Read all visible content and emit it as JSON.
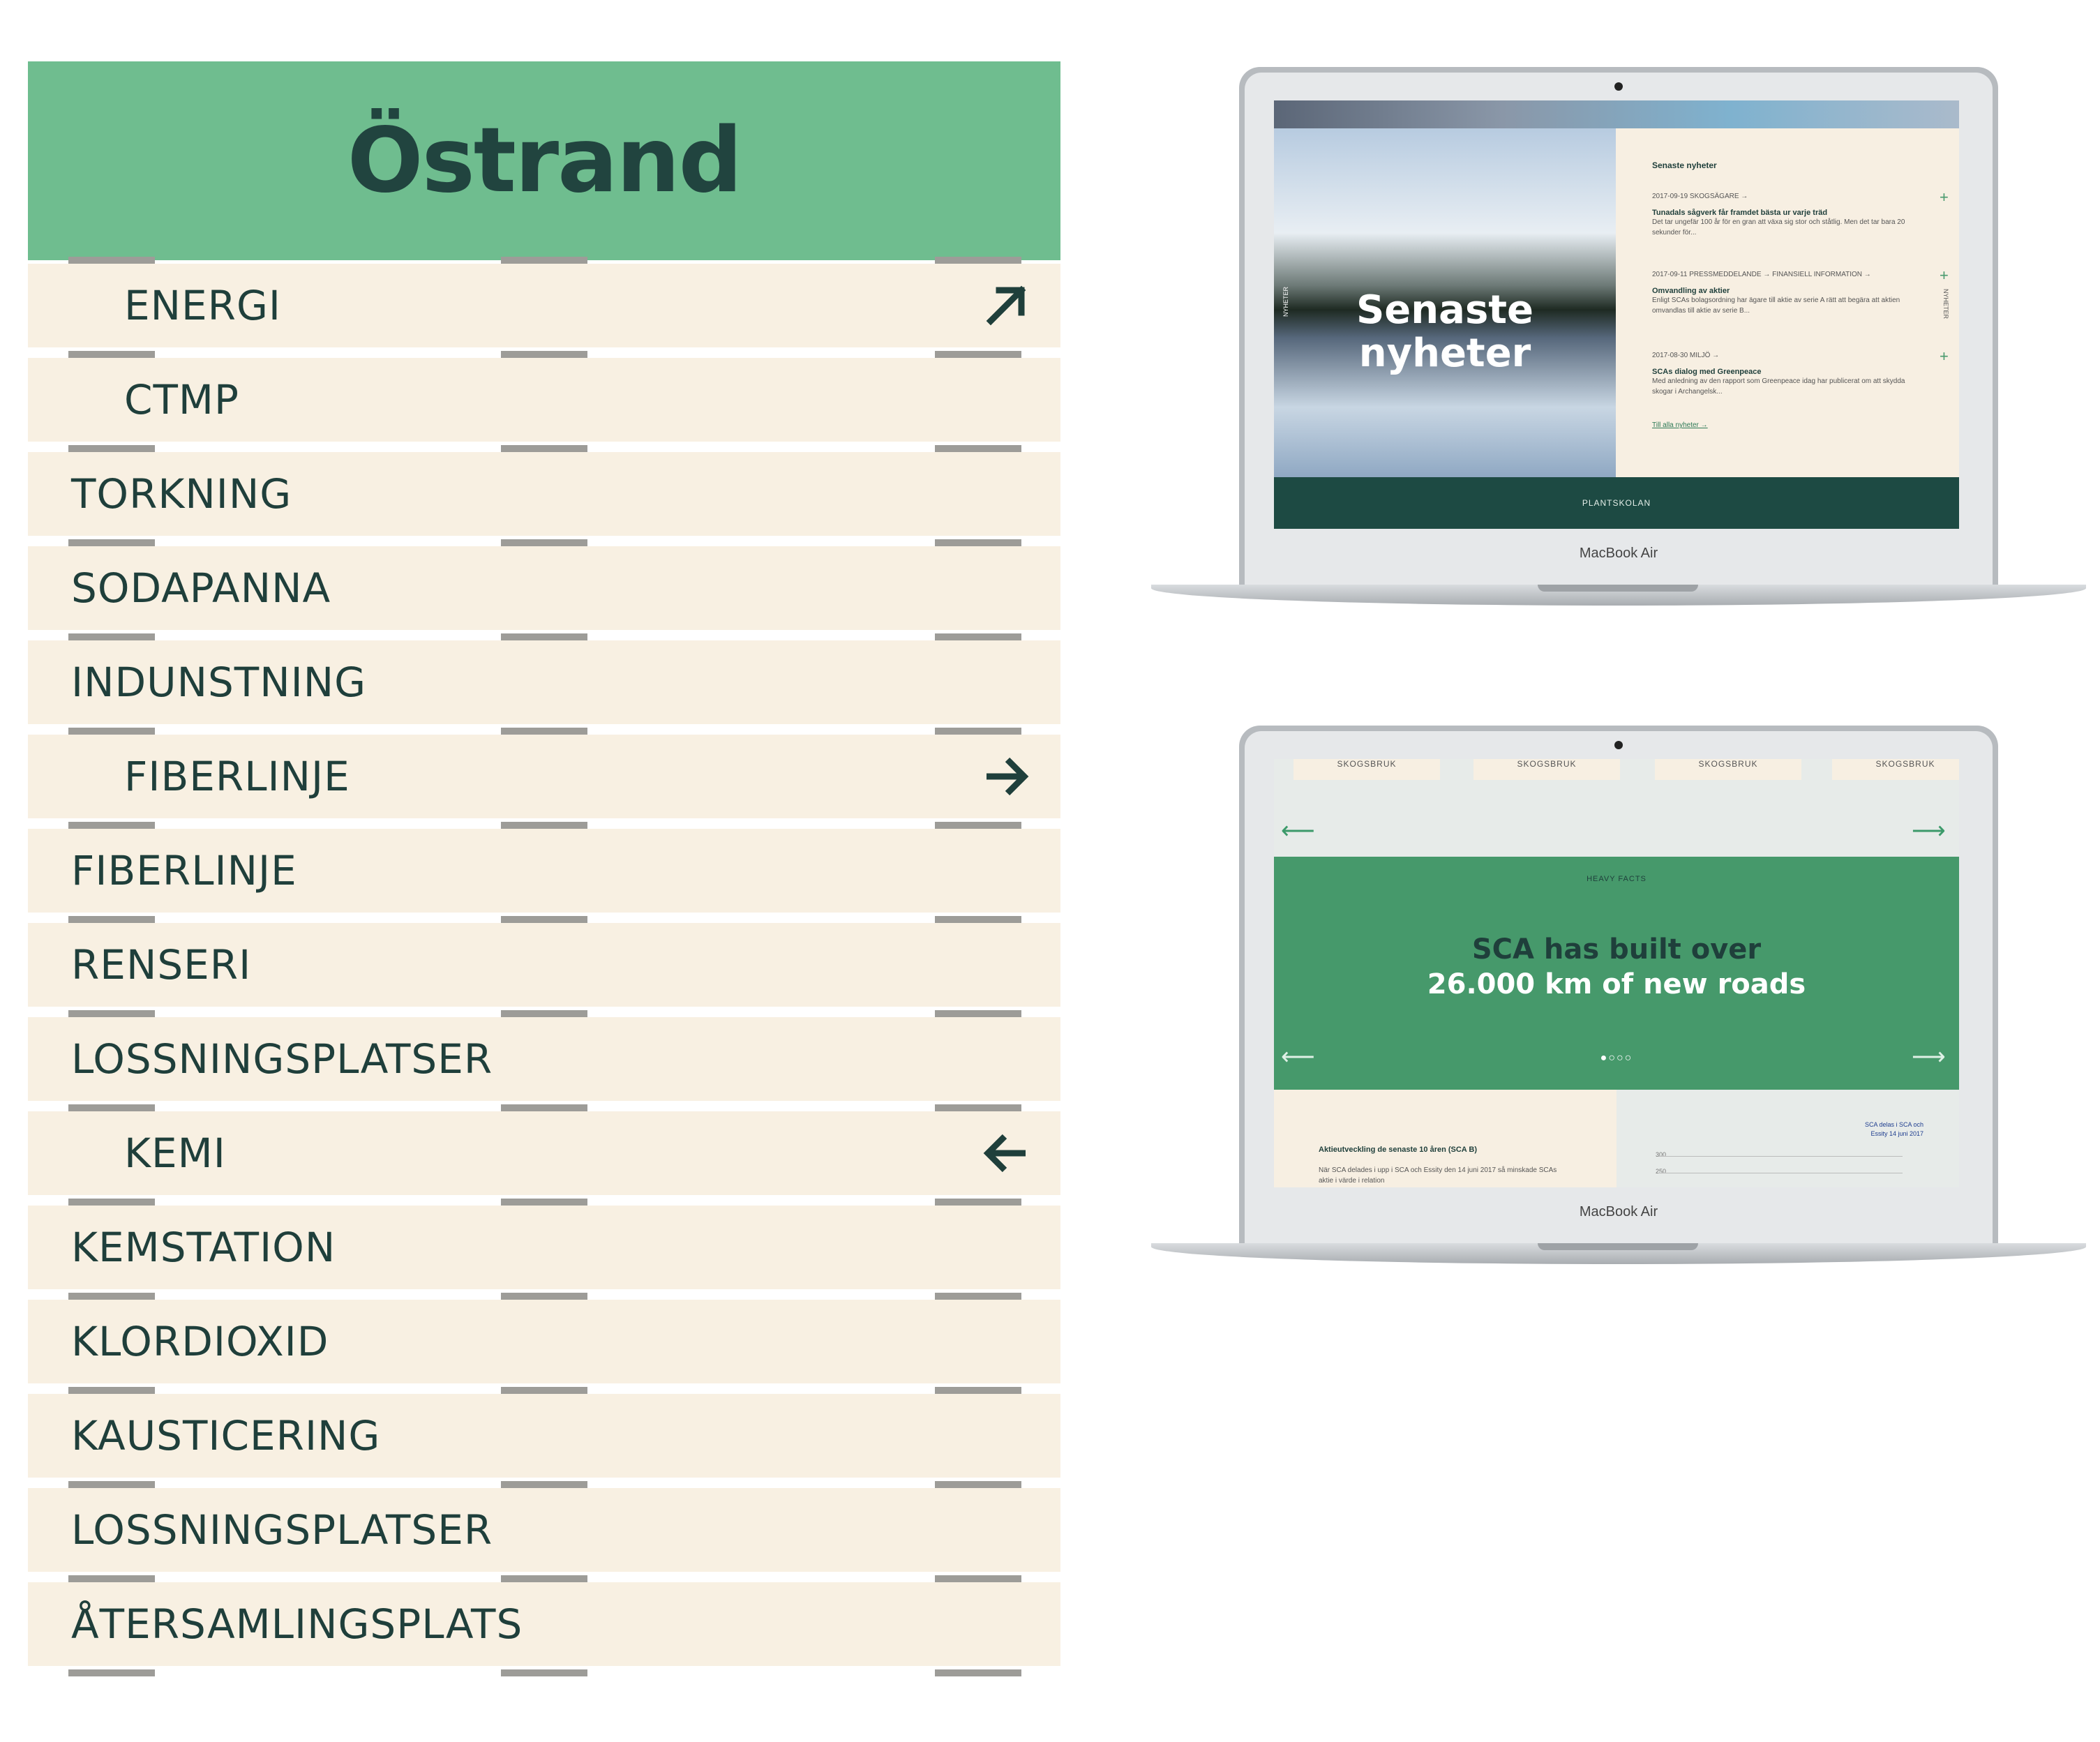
{
  "sign": {
    "title": "Östrand",
    "planks": [
      {
        "label": "ENERGI",
        "indent": true,
        "arrow": "arrow-up-right-icon"
      },
      {
        "label": "CTMP",
        "indent": true,
        "arrow": null
      },
      {
        "label": "TORKNING",
        "indent": false,
        "arrow": null
      },
      {
        "label": "SODAPANNA",
        "indent": false,
        "arrow": null
      },
      {
        "label": "INDUNSTNING",
        "indent": false,
        "arrow": null
      },
      {
        "label": "FIBERLINJE",
        "indent": true,
        "arrow": "arrow-right-icon"
      },
      {
        "label": "FIBERLINJE",
        "indent": false,
        "arrow": null
      },
      {
        "label": "RENSERI",
        "indent": false,
        "arrow": null
      },
      {
        "label": "LOSSNINGSPLATSER",
        "indent": false,
        "arrow": null
      },
      {
        "label": "KEMI",
        "indent": true,
        "arrow": "arrow-left-icon"
      },
      {
        "label": "KEMSTATION",
        "indent": false,
        "arrow": null
      },
      {
        "label": "KLORDIOXID",
        "indent": false,
        "arrow": null
      },
      {
        "label": "KAUSTICERING",
        "indent": false,
        "arrow": null
      },
      {
        "label": "LOSSNINGSPLATSER",
        "indent": false,
        "arrow": null
      },
      {
        "label": "ÅTERSAMLINGSPLATS",
        "indent": false,
        "arrow": null
      }
    ],
    "colors": {
      "header": "#6fbd8f",
      "plank": "#f8f0e2",
      "text": "#1f3f3b",
      "bracket": "#9d9c98"
    }
  },
  "laptop1": {
    "brand": "MacBook Air",
    "hero_title": "Senaste nyheter",
    "side_label": "NYHETER",
    "news_heading": "Senaste nyheter",
    "news": [
      {
        "meta": "2017-09-19  SKOGSÄGARE →",
        "title": "Tunadals sågverk får framdet bästa ur varje träd",
        "body": "Det tar ungefär 100 år för en gran att växa sig stor och ståtlig. Men det tar bara 20 sekunder för..."
      },
      {
        "meta": "2017-09-11  PRESSMEDDELANDE →  FINANSIELL INFORMATION →",
        "title": "Omvandling av aktier",
        "body": "Enligt SCAs bolagsordning har ägare till aktie av serie A rätt att begära att aktien omvandlas till aktie av serie B..."
      },
      {
        "meta": "2017-08-30  MILJÖ →",
        "title": "SCAs dialog med Greenpeace",
        "body": "Med anledning av den rapport som Greenpeace idag har publicerat om att skydda skogar i Archangelsk..."
      }
    ],
    "all_news_link": "Till alla nyheter →",
    "footer": "PLANTSKOLAN"
  },
  "laptop2": {
    "brand": "MacBook Air",
    "tags": [
      "SKOGSBRUK",
      "SKOGSBRUK",
      "SKOGSBRUK",
      "SKOGSBRUK"
    ],
    "kicker": "HEAVY FACTS",
    "fact_line1": "SCA has built over",
    "fact_line2": "26.000 km of new roads",
    "dots": "●○○○",
    "stock_heading": "Aktieutveckling de senaste 10 åren (SCA B)",
    "stock_body": "När SCA delades i upp i SCA och Essity den 14 juni 2017 så minskade SCAs aktie i värde i relation",
    "chart_note": "SCA delas i SCA och Essity 14 juni 2017",
    "ticks": [
      "300",
      "250"
    ]
  }
}
